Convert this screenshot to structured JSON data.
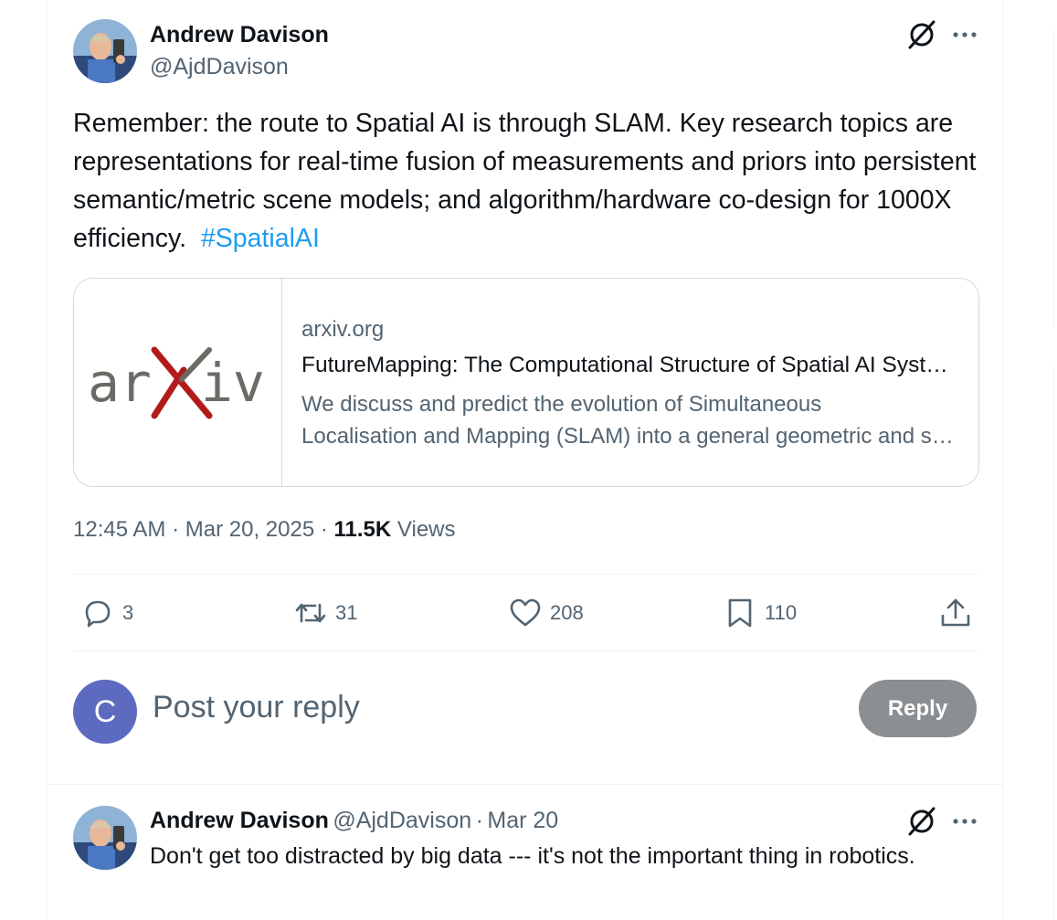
{
  "main_post": {
    "author_name": "Andrew Davison",
    "author_handle": "@AjdDavison",
    "text": "Remember: the route to Spatial AI is through SLAM. Key research topics are representations for real-time fusion of measurements and priors into persistent semantic/metric scene models; and algorithm/hardware co-design for 1000X efficiency.",
    "hashtag": "#SpatialAI",
    "link_card": {
      "domain": "arxiv.org",
      "title": "FutureMapping: The Computational Structure of Spatial AI Systems",
      "description_line1": "We discuss and predict the evolution of Simultaneous",
      "description_line2": "Localisation and Mapping (SLAM) into a general geometric and semantic Spatial AI perception capability",
      "logo_text_left": "ar",
      "logo_text_right": "iv"
    },
    "time": "12:45 AM",
    "date": "Mar 20, 2025",
    "views_count": "11.5K",
    "views_label": "Views",
    "actions": {
      "replies": "3",
      "reposts": "31",
      "likes": "208",
      "bookmarks": "110"
    }
  },
  "reply_composer": {
    "avatar_letter": "C",
    "placeholder": "Post your reply",
    "button_label": "Reply"
  },
  "second_post": {
    "author_name": "Andrew Davison",
    "author_handle": "@AjdDavison",
    "separator": "·",
    "date": "Mar 20",
    "text": "Don't get too distracted by big data --- it's not the important thing in robotics."
  },
  "icons": [
    "grok-icon",
    "more-icon",
    "reply-icon",
    "repost-icon",
    "like-icon",
    "bookmark-icon",
    "share-icon"
  ],
  "colors": {
    "accent": "#1d9bf0",
    "text": "#0f1419",
    "muted": "#536471",
    "border": "#cfd9de",
    "reply_button": "#8b8f92",
    "avatar_bg": "#5c6bc0"
  }
}
